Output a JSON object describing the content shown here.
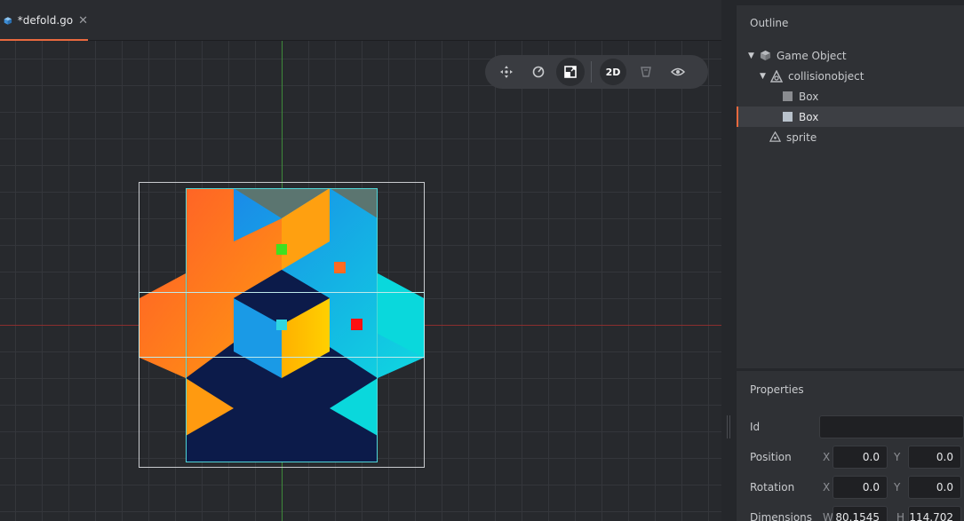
{
  "tab": {
    "title": "*defold.go",
    "close": "✕"
  },
  "toolbar": {
    "mode_2d": "2D"
  },
  "outline": {
    "title": "Outline",
    "items": [
      {
        "label": "Game Object",
        "icon": "game-object-cube-icon"
      },
      {
        "label": "collisionobject",
        "icon": "collision-object-icon"
      },
      {
        "label": "Box",
        "icon": "box-shape-icon"
      },
      {
        "label": "Box",
        "icon": "box-shape-icon",
        "selected": true
      },
      {
        "label": "sprite",
        "icon": "sprite-icon"
      }
    ]
  },
  "properties": {
    "title": "Properties",
    "id": {
      "label": "Id",
      "value": ""
    },
    "position": {
      "label": "Position",
      "x_label": "X",
      "x": "0.0",
      "y_label": "Y",
      "y": "0.0"
    },
    "rotation": {
      "label": "Rotation",
      "x_label": "X",
      "x": "0.0",
      "y_label": "Y",
      "y": "0.0"
    },
    "dimensions": {
      "label": "Dimensions",
      "w_label": "W",
      "w": "80.1545",
      "h_label": "H",
      "h": "114.702"
    }
  },
  "colors": {
    "accent": "#e9693e",
    "axis_x": "#8a2e2e",
    "axis_y": "#3e8a3a",
    "selection": "#4fd6d8"
  }
}
